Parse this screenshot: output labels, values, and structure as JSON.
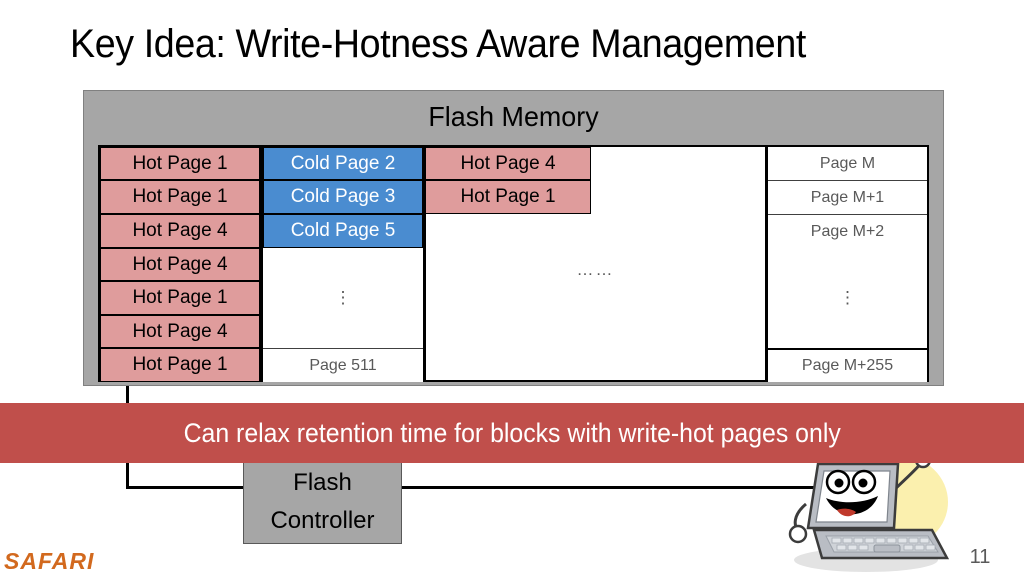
{
  "slide": {
    "title": "Key Idea: Write-Hotness Aware Management",
    "page_number": "11",
    "logo": "SAFARI"
  },
  "flash_memory": {
    "heading": "Flash Memory",
    "panel_color": "#a6a6a6",
    "hot_color": "#df9c9c",
    "cold_color": "#4a8cd0",
    "blocks": [
      {
        "name": "block-1",
        "rows": [
          {
            "label": "Hot Page 1",
            "kind": "hot"
          },
          {
            "label": "Hot Page 1",
            "kind": "hot"
          },
          {
            "label": "Hot Page 4",
            "kind": "hot"
          },
          {
            "label": "Hot Page 4",
            "kind": "hot"
          },
          {
            "label": "Hot Page 1",
            "kind": "hot"
          },
          {
            "label": "Hot Page 4",
            "kind": "hot"
          },
          {
            "label": "Hot Page 1",
            "kind": "hot"
          }
        ]
      },
      {
        "name": "block-2",
        "rows": [
          {
            "label": "Cold Page 2",
            "kind": "cold"
          },
          {
            "label": "Cold Page 3",
            "kind": "cold"
          },
          {
            "label": "Cold Page 5",
            "kind": "cold"
          }
        ],
        "vertical_ellipsis": "⋮",
        "last_row": {
          "label": "Page 511",
          "kind": "plain"
        }
      },
      {
        "name": "block-3",
        "rows": [
          {
            "label": "Hot Page 4",
            "kind": "hot"
          },
          {
            "label": "Hot Page 1",
            "kind": "hot"
          }
        ],
        "horizontal_ellipsis": "……"
      },
      {
        "name": "block-4",
        "rows": [
          {
            "label": "Page M",
            "kind": "plain"
          },
          {
            "label": "Page M+1",
            "kind": "plain"
          },
          {
            "label": "Page M+2",
            "kind": "plain"
          }
        ],
        "vertical_ellipsis": "⋮",
        "last_row": {
          "label": "Page M+255",
          "kind": "plain"
        }
      }
    ]
  },
  "controller": {
    "line1": "Flash",
    "line2": "Controller"
  },
  "callout": {
    "text": "Can relax retention time for blocks with write-hot pages only",
    "background": "#c04f4b",
    "text_color": "#ffffff"
  },
  "mascot": {
    "icon": "laptop-character-icon"
  }
}
